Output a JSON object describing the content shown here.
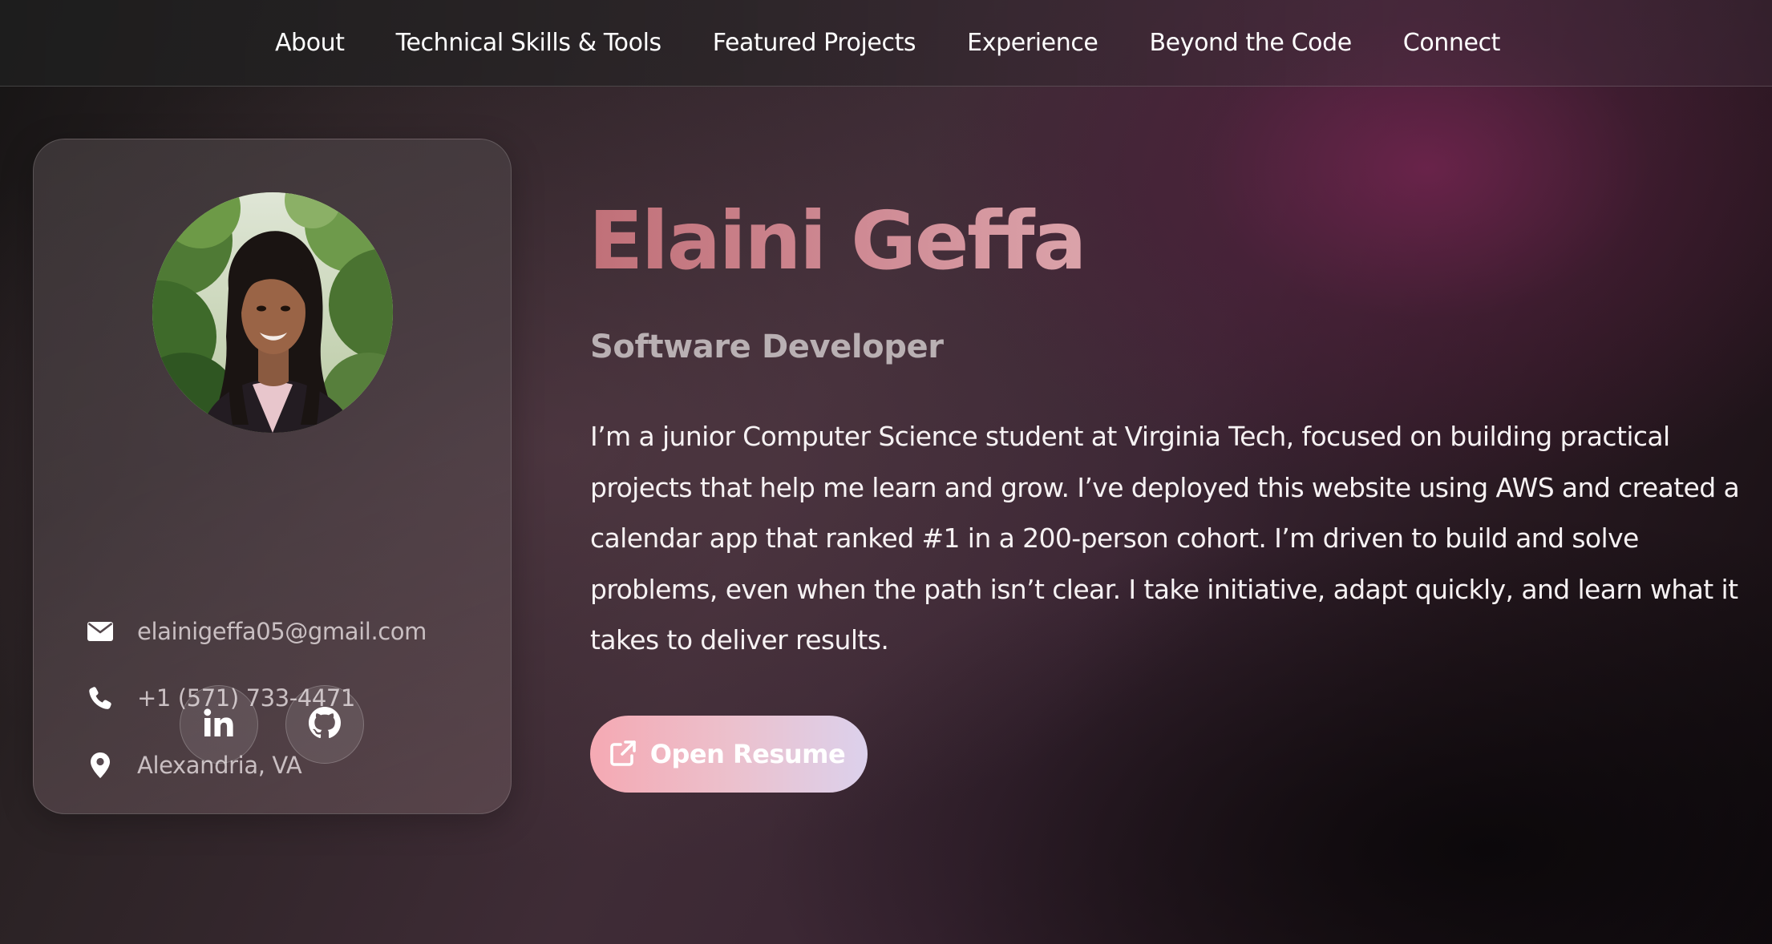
{
  "nav": {
    "items": [
      {
        "label": "About"
      },
      {
        "label": "Technical Skills & Tools"
      },
      {
        "label": "Featured Projects"
      },
      {
        "label": "Experience"
      },
      {
        "label": "Beyond the Code"
      },
      {
        "label": "Connect"
      }
    ]
  },
  "profile": {
    "avatar_icon": "portrait-photo",
    "contacts": {
      "email": {
        "icon": "envelope-icon",
        "text": "elainigeffa05@gmail.com"
      },
      "phone": {
        "icon": "phone-icon",
        "text": "+1 (571) 733-4471"
      },
      "location": {
        "icon": "map-pin-icon",
        "text": "Alexandria, VA"
      }
    },
    "social": [
      {
        "icon": "linkedin-icon"
      },
      {
        "icon": "github-icon"
      }
    ]
  },
  "hero": {
    "name": "Elaini Geffa",
    "role": "Software Developer",
    "bio": "I’m a junior Computer Science student at Virginia Tech, focused on building practical projects that help me learn and grow. I’ve deployed this website using AWS and created a calendar app that ranked #1 in a 200-person cohort. I’m driven to build and solve problems, even when the path isn’t clear. I take initiative, adapt quickly, and learn what it takes to deliver results.",
    "resume_button": {
      "icon": "external-link-icon",
      "label": "Open Resume"
    }
  },
  "colors": {
    "name_gradient_start": "#c07078",
    "name_gradient_end": "#dba3aa",
    "button_gradient_start": "#f5a9b3",
    "button_gradient_end": "#dcd1ec",
    "secondary_text": "#b9b0b3"
  }
}
